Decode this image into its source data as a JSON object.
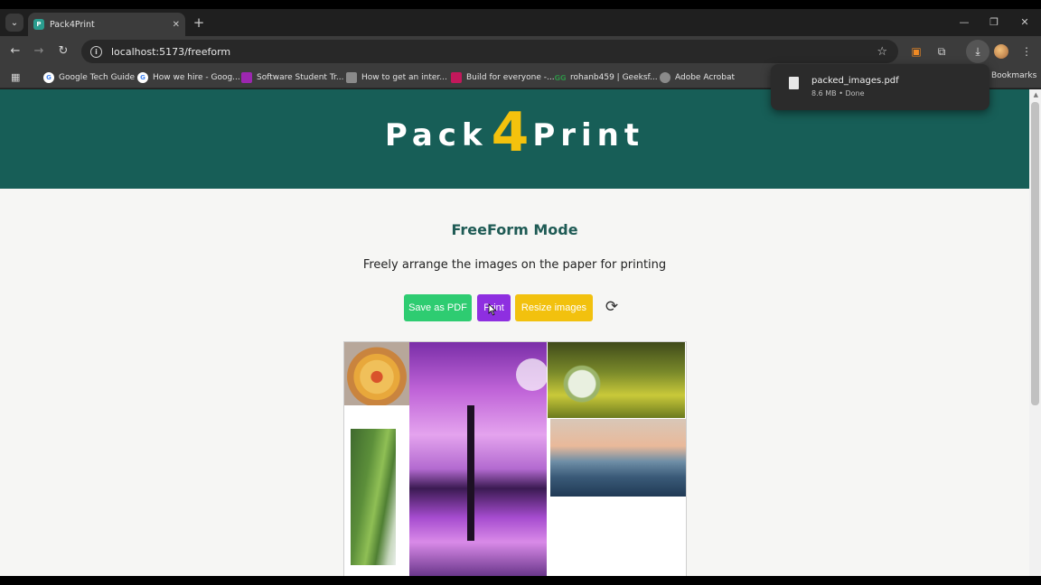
{
  "browser": {
    "tab_title": "Pack4Print",
    "url": "localhost:5173/freeform",
    "bookmarks": [
      {
        "label": "Google Tech Guide",
        "icon": "google-icon",
        "color": "#4285f4"
      },
      {
        "label": "How we hire - Goog...",
        "icon": "google-icon",
        "color": "#4285f4"
      },
      {
        "label": "Software Student Tr...",
        "icon": "bookmark-icon",
        "color": "#9c27b0"
      },
      {
        "label": "How to get an inter...",
        "icon": "doc-icon",
        "color": "#8a8a8a"
      },
      {
        "label": "Build for everyone -...",
        "icon": "bookmark-icon",
        "color": "#c2185b"
      },
      {
        "label": "rohanb459 | Geeksf...",
        "icon": "gfg-icon",
        "color": "#2f8d46"
      },
      {
        "label": "Adobe Acrobat",
        "icon": "globe-icon",
        "color": "#8a8a8a"
      }
    ],
    "bookmarks_folder": "Bookmarks"
  },
  "download": {
    "filename": "packed_images.pdf",
    "status": "8.6 MB • Done"
  },
  "page": {
    "logo_left": "Pack",
    "logo_mid": "4",
    "logo_right": "Print",
    "title": "FreeForm Mode",
    "subtitle": "Freely arrange the images on the paper for printing",
    "buttons": {
      "save_pdf": "Save as PDF",
      "print": "Print",
      "resize": "Resize images"
    }
  },
  "colors": {
    "header": "#175e57",
    "accent_yellow": "#f4c20d",
    "save_green": "#2ecc71",
    "print_purple": "#8e2fe0"
  }
}
